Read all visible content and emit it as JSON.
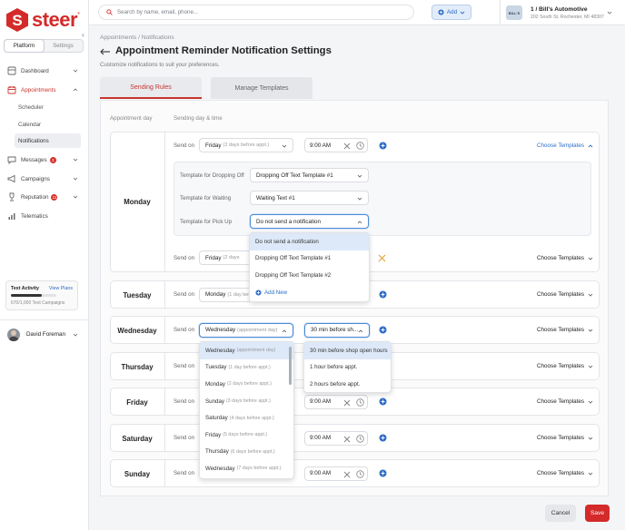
{
  "brand": {
    "name": "steer",
    "accent": "#d42a2a",
    "link": "#2d6dc8"
  },
  "sidebar": {
    "toggle": [
      "Platform",
      "Settings"
    ],
    "items": [
      {
        "label": "Dashboard",
        "icon": "dashboard-icon"
      },
      {
        "label": "Appointments",
        "icon": "calendar-icon",
        "active": true
      },
      {
        "label": "Messages",
        "icon": "chat-icon",
        "badge": "3"
      },
      {
        "label": "Campaigns",
        "icon": "megaphone-icon"
      },
      {
        "label": "Reputation",
        "icon": "trophy-icon",
        "badge": "11"
      },
      {
        "label": "Telematics",
        "icon": "signal-icon"
      }
    ],
    "subitems": [
      "Scheduler",
      "Calendar",
      "Notifications"
    ],
    "activity": {
      "title": "Text Activity",
      "link": "View Plans",
      "usage": "670/1,000 Text Campaigns",
      "fraction": 0.67
    },
    "user": "David Foreman"
  },
  "topbar": {
    "search_placeholder": "Search by name, email, phone...",
    "add_label": "Add",
    "store_logo": "BILL'S",
    "store_name": "1 / Bill's Automotive",
    "store_address": "202 South St, Rochester, MI 48307"
  },
  "page": {
    "breadcrumb": "Appointments / Notifications",
    "title": "Appointment Reminder Notification Settings",
    "subtitle": "Customize notifications to suit your preferences.",
    "tabs": [
      "Sending Rules",
      "Manage Templates"
    ],
    "col_day": "Appointment day",
    "col_send": "Sending day & time",
    "send_on": "Send on",
    "choose_templates": "Choose Templates",
    "cancel": "Cancel",
    "save": "Save"
  },
  "monday": {
    "day": "Monday",
    "send_day": "Friday",
    "send_hint": "(2 days before appt.)",
    "time": "9:00 AM",
    "templates": [
      {
        "label": "Template for Dropping Off",
        "value": "Dropping Off Text Template #1"
      },
      {
        "label": "Template for Waiting",
        "value": "Waiting Text #1"
      },
      {
        "label": "Template for Pick Up",
        "value": "Do not send a notification"
      }
    ],
    "second_send_day": "Friday",
    "second_send_hint": "(2 days"
  },
  "pickup_menu": [
    "Do not send a notification",
    "Dropping Off Text Template #1",
    "Dropping Off Text Template #2"
  ],
  "pickup_add_new": "Add New",
  "days": [
    {
      "day": "Tuesday",
      "send_day": "Monday",
      "send_hint": "(1 day bef",
      "time": ""
    },
    {
      "day": "Wednesday",
      "send_day": "Wednesday",
      "send_hint": "(appointment day)",
      "time": "30 min before sh..."
    },
    {
      "day": "Thursday",
      "send_day": "",
      "send_hint": "",
      "time": ""
    },
    {
      "day": "Friday",
      "send_day": "",
      "send_hint": "",
      "time": "9:00 AM"
    },
    {
      "day": "Saturday",
      "send_day": "",
      "send_hint": "",
      "time": "9:00 AM"
    },
    {
      "day": "Sunday",
      "send_day": "",
      "send_hint": "",
      "time": "9:00 AM"
    }
  ],
  "day_menu": [
    {
      "day": "Wednesday",
      "hint": "(appointment day)"
    },
    {
      "day": "Tuesday",
      "hint": "(1 day before appt.)"
    },
    {
      "day": "Monday",
      "hint": "(2 days before appt.)"
    },
    {
      "day": "Sunday",
      "hint": "(3 days before appt.)"
    },
    {
      "day": "Saturday",
      "hint": "(4 days before appt.)"
    },
    {
      "day": "Friday",
      "hint": "(5 days before appt.)"
    },
    {
      "day": "Thursday",
      "hint": "(6 days before appt.)"
    },
    {
      "day": "Wednesday",
      "hint": "(7 days before appt.)"
    }
  ],
  "time_menu": [
    "30 min before shop open hours",
    "1 hour before appt.",
    "2 hours before appt."
  ]
}
